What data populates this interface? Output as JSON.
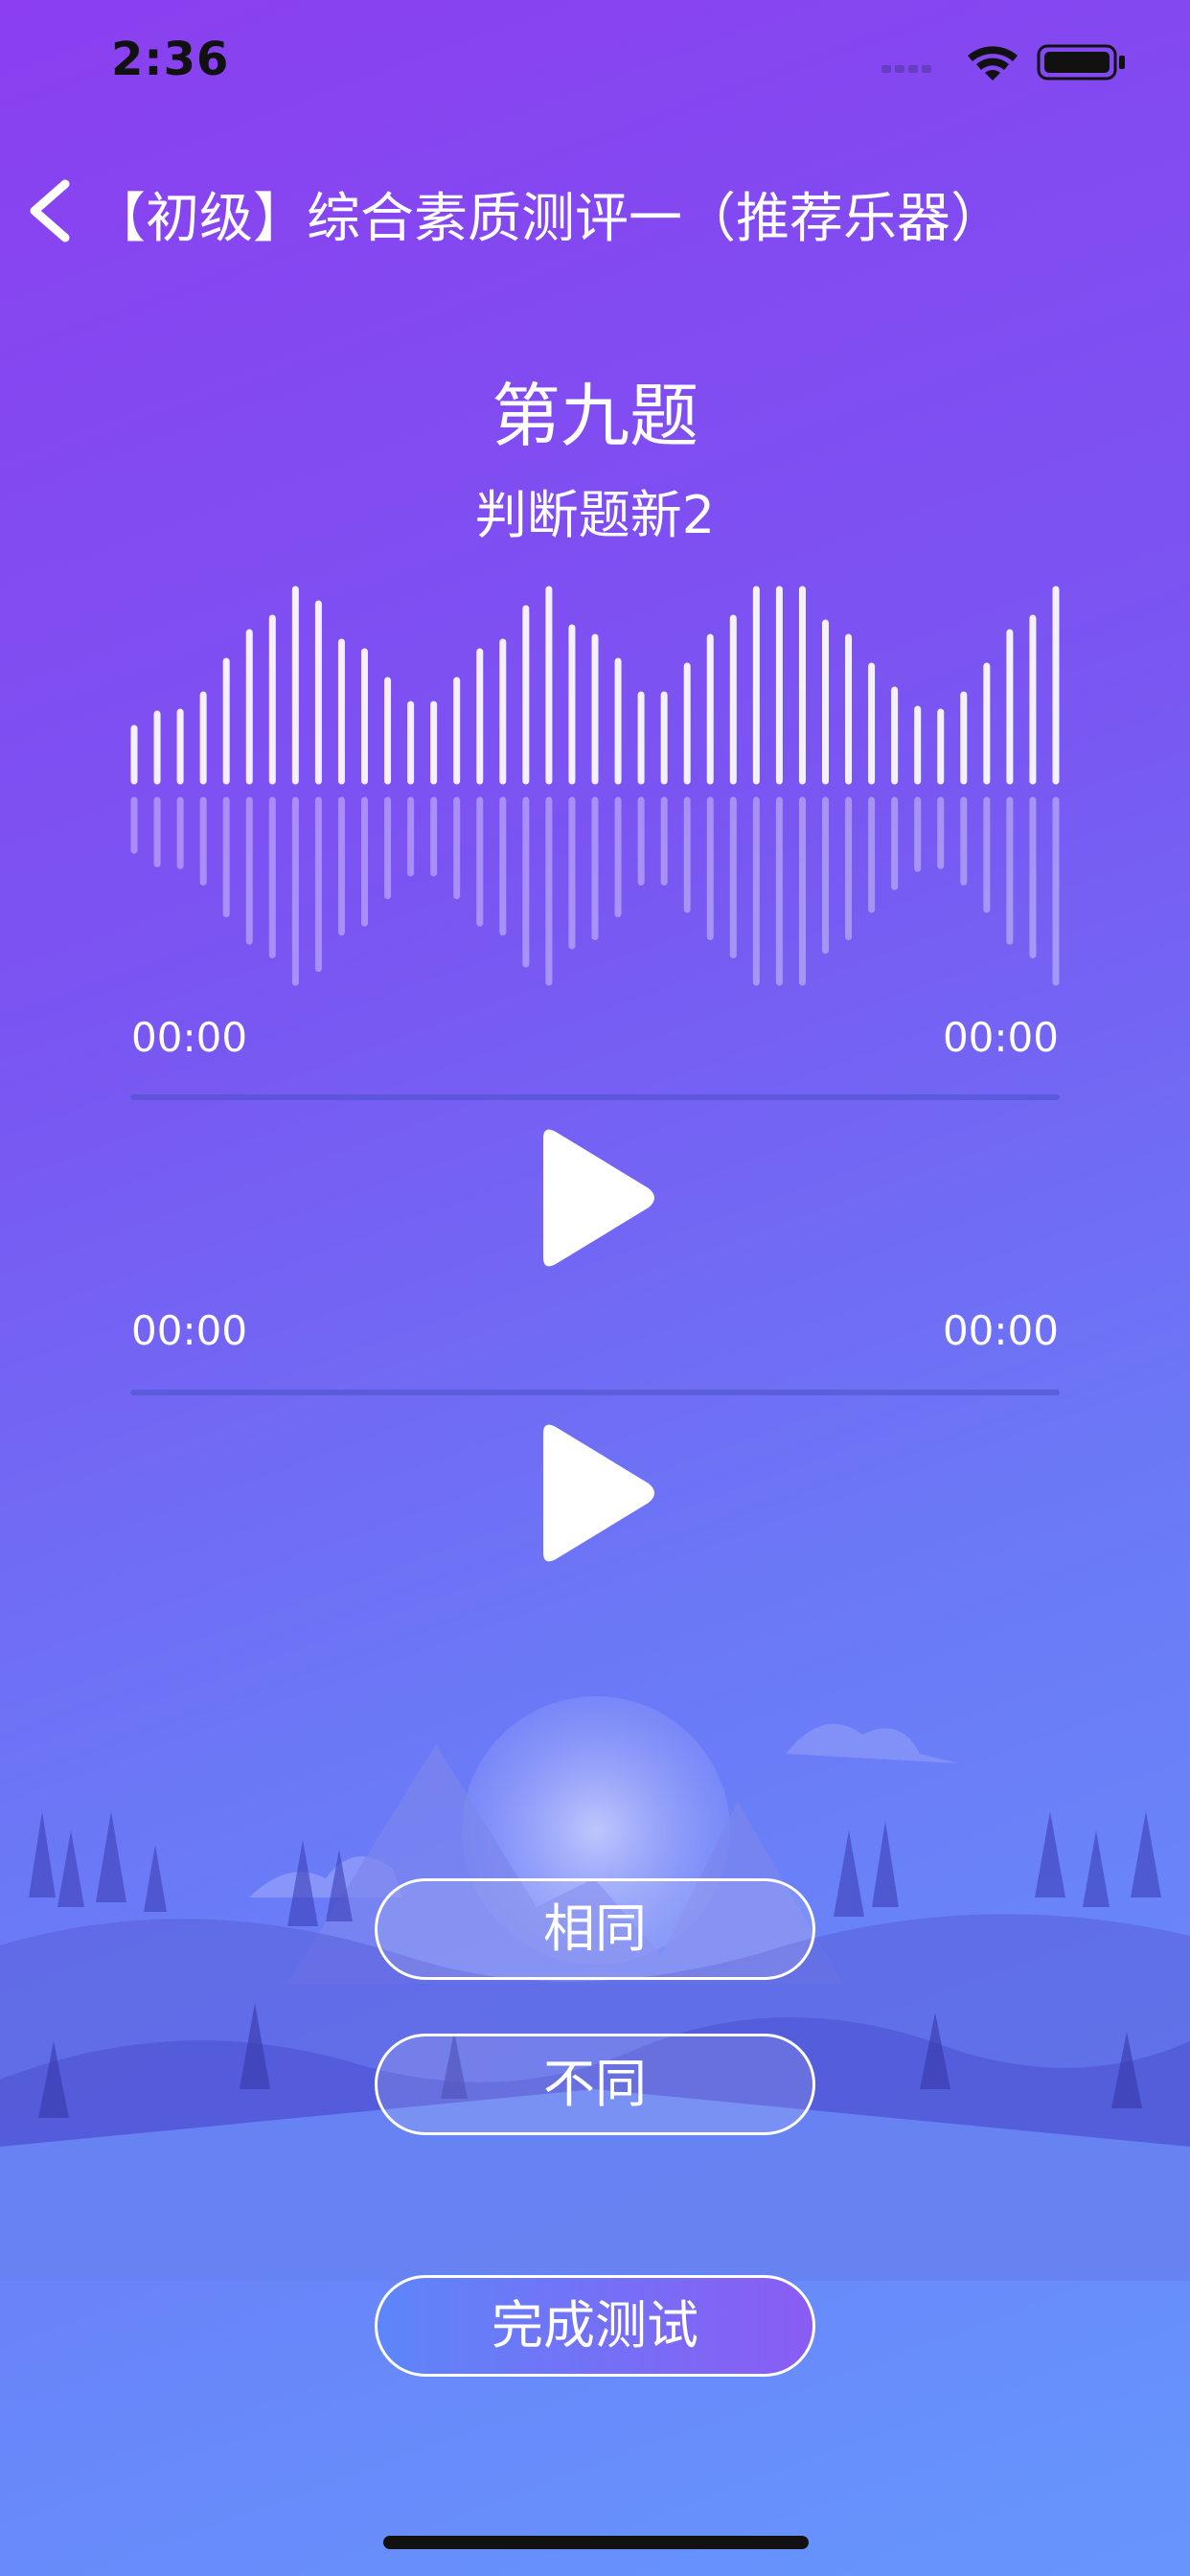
{
  "status_bar": {
    "time": "2:36"
  },
  "nav": {
    "title": "【初级】综合素质测评一（推荐乐器）"
  },
  "question": {
    "number_label": "第九题",
    "subtitle": "判断题新2"
  },
  "player_1": {
    "current_time": "00:00",
    "total_time": "00:00",
    "progress": 0
  },
  "player_2": {
    "current_time": "00:00",
    "total_time": "00:00",
    "progress": 0
  },
  "answers": {
    "same_label": "相同",
    "different_label": "不同"
  },
  "finish_button": {
    "label": "完成测试"
  },
  "colors": {
    "bg_top": "#8b3ff0",
    "bg_bottom": "#6696fd",
    "accent": "#ffffff"
  }
}
